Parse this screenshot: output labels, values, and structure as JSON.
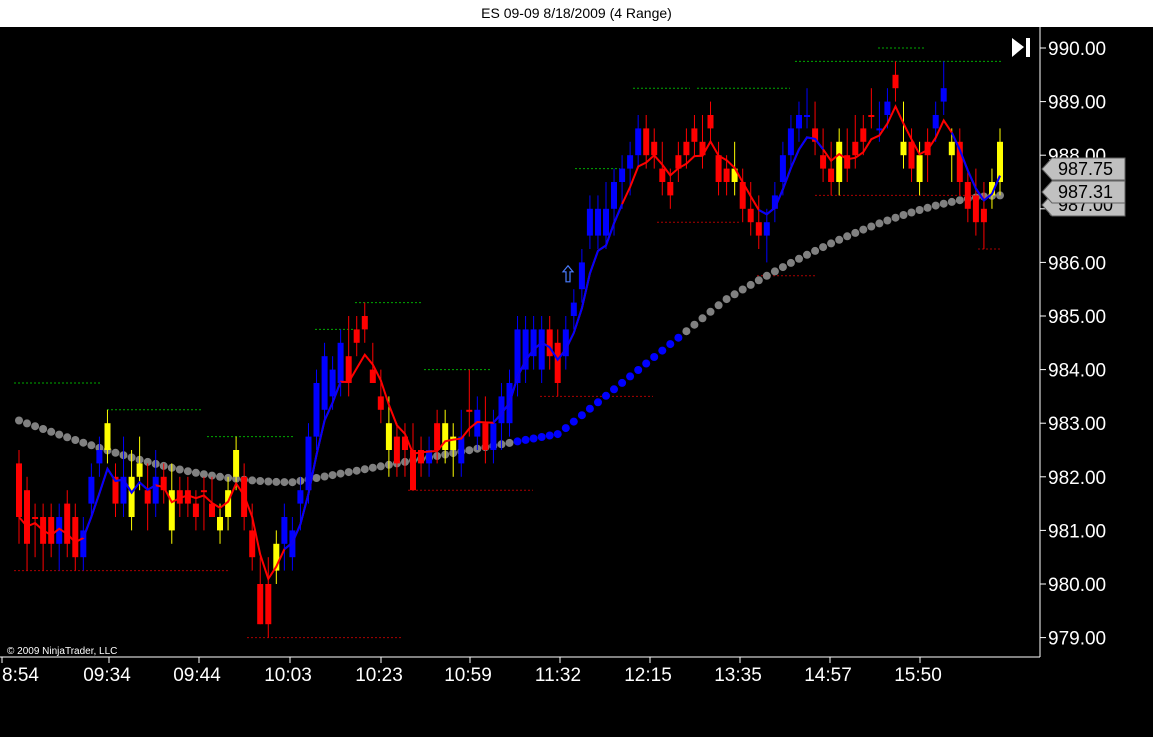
{
  "window": {
    "title": "ES 09-09  8/18/2009 (4 Range)"
  },
  "copyright": "© 2009 NinjaTrader, LLC",
  "colors": {
    "up": "#0000ff",
    "down": "#ff0000",
    "neutral": "#ffff00",
    "ema": "#ff0000",
    "sma": "#808080",
    "background": "#000000",
    "text": "#ffffff",
    "label_bg": "#c0c0c0"
  },
  "icons": {
    "go_to_end": "skip-to-end-icon",
    "entry_arrow": "up-arrow-icon"
  },
  "chart_data": {
    "type": "candlestick",
    "title": "ES 09-09  8/18/2009 (4 Range)",
    "ylim": [
      978.75,
      990.25
    ],
    "y_ticks": [
      "990.00",
      "989.00",
      "988.00",
      "987.00",
      "986.00",
      "985.00",
      "984.00",
      "983.00",
      "982.00",
      "981.00",
      "980.00",
      "979.00"
    ],
    "x_tick_labels": [
      {
        "bar": 0,
        "label": "8:54"
      },
      {
        "bar": 10,
        "label": "09:34"
      },
      {
        "bar": 20,
        "label": "09:44"
      },
      {
        "bar": 30,
        "label": "10:03"
      },
      {
        "bar": 40,
        "label": "10:23"
      },
      {
        "bar": 50,
        "label": "10:59"
      },
      {
        "bar": 60,
        "label": "11:32"
      },
      {
        "bar": 70,
        "label": "12:15"
      },
      {
        "bar": 80,
        "label": "13:35"
      },
      {
        "bar": 90,
        "label": "14:57"
      },
      {
        "bar": 100,
        "label": "15:50"
      }
    ],
    "price_labels": [
      "987.75",
      "987.31",
      "987.00"
    ],
    "grid": false,
    "bars": [
      {
        "o": 982.25,
        "h": 982.5,
        "l": 980.75,
        "c": 981.25,
        "col": "down"
      },
      {
        "o": 981.75,
        "h": 982.0,
        "l": 980.25,
        "c": 980.75,
        "col": "down"
      },
      {
        "o": 981.25,
        "h": 981.5,
        "l": 980.5,
        "c": 981.25,
        "col": "down"
      },
      {
        "o": 981.25,
        "h": 981.5,
        "l": 980.25,
        "c": 980.75,
        "col": "down"
      },
      {
        "o": 981.25,
        "h": 981.5,
        "l": 980.5,
        "c": 980.75,
        "col": "down"
      },
      {
        "o": 980.75,
        "h": 981.5,
        "l": 980.25,
        "c": 981.25,
        "col": "up"
      },
      {
        "o": 981.5,
        "h": 981.75,
        "l": 980.5,
        "c": 980.75,
        "col": "down"
      },
      {
        "o": 981.25,
        "h": 981.5,
        "l": 980.25,
        "c": 980.5,
        "col": "down"
      },
      {
        "o": 980.5,
        "h": 981.25,
        "l": 980.25,
        "c": 981.0,
        "col": "up"
      },
      {
        "o": 981.5,
        "h": 982.25,
        "l": 981.25,
        "c": 982.0,
        "col": "up"
      },
      {
        "o": 982.25,
        "h": 982.75,
        "l": 982.0,
        "c": 982.5,
        "col": "up"
      },
      {
        "o": 982.5,
        "h": 983.25,
        "l": 982.25,
        "c": 983.0,
        "col": "neutral"
      },
      {
        "o": 982.0,
        "h": 982.25,
        "l": 981.25,
        "c": 981.5,
        "col": "down"
      },
      {
        "o": 981.5,
        "h": 982.75,
        "l": 981.25,
        "c": 982.0,
        "col": "up"
      },
      {
        "o": 982.0,
        "h": 982.5,
        "l": 981.0,
        "c": 981.25,
        "col": "neutral"
      },
      {
        "o": 982.0,
        "h": 982.75,
        "l": 981.75,
        "c": 982.25,
        "col": "neutral"
      },
      {
        "o": 981.75,
        "h": 982.25,
        "l": 981.0,
        "c": 981.5,
        "col": "down"
      },
      {
        "o": 981.5,
        "h": 982.5,
        "l": 981.25,
        "c": 982.0,
        "col": "up"
      },
      {
        "o": 982.0,
        "h": 982.25,
        "l": 981.5,
        "c": 981.75,
        "col": "down"
      },
      {
        "o": 981.75,
        "h": 982.25,
        "l": 980.75,
        "c": 981.0,
        "col": "neutral"
      },
      {
        "o": 981.5,
        "h": 982.0,
        "l": 981.25,
        "c": 981.75,
        "col": "down"
      },
      {
        "o": 981.5,
        "h": 982.0,
        "l": 981.25,
        "c": 981.75,
        "col": "down"
      },
      {
        "o": 981.25,
        "h": 981.75,
        "l": 981.0,
        "c": 981.5,
        "col": "down"
      },
      {
        "o": 981.75,
        "h": 982.0,
        "l": 981.0,
        "c": 981.75,
        "col": "down"
      },
      {
        "o": 981.5,
        "h": 982.0,
        "l": 981.25,
        "c": 981.25,
        "col": "down"
      },
      {
        "o": 981.0,
        "h": 981.5,
        "l": 980.75,
        "c": 981.25,
        "col": "neutral"
      },
      {
        "o": 981.25,
        "h": 982.0,
        "l": 981.0,
        "c": 981.75,
        "col": "neutral"
      },
      {
        "o": 982.0,
        "h": 982.75,
        "l": 981.75,
        "c": 982.5,
        "col": "neutral"
      },
      {
        "o": 982.0,
        "h": 982.25,
        "l": 981.0,
        "c": 981.25,
        "col": "down"
      },
      {
        "o": 981.0,
        "h": 981.5,
        "l": 980.25,
        "c": 980.5,
        "col": "down"
      },
      {
        "o": 980.0,
        "h": 980.5,
        "l": 979.25,
        "c": 979.25,
        "col": "down"
      },
      {
        "o": 980.0,
        "h": 980.5,
        "l": 979.0,
        "c": 979.25,
        "col": "down"
      },
      {
        "o": 980.25,
        "h": 981.0,
        "l": 980.0,
        "c": 980.75,
        "col": "neutral"
      },
      {
        "o": 980.75,
        "h": 981.5,
        "l": 980.25,
        "c": 981.25,
        "col": "up"
      },
      {
        "o": 980.5,
        "h": 981.25,
        "l": 980.25,
        "c": 981.0,
        "col": "up"
      },
      {
        "o": 981.5,
        "h": 982.0,
        "l": 981.0,
        "c": 981.75,
        "col": "up"
      },
      {
        "o": 981.75,
        "h": 983.0,
        "l": 981.5,
        "c": 982.75,
        "col": "up"
      },
      {
        "o": 982.75,
        "h": 984.0,
        "l": 982.5,
        "c": 983.75,
        "col": "up"
      },
      {
        "o": 983.25,
        "h": 984.5,
        "l": 983.0,
        "c": 984.25,
        "col": "up"
      },
      {
        "o": 983.5,
        "h": 984.25,
        "l": 983.25,
        "c": 984.0,
        "col": "up"
      },
      {
        "o": 983.75,
        "h": 984.75,
        "l": 983.5,
        "c": 984.5,
        "col": "up"
      },
      {
        "o": 984.25,
        "h": 985.0,
        "l": 983.5,
        "c": 983.75,
        "col": "down"
      },
      {
        "o": 984.75,
        "h": 985.0,
        "l": 984.25,
        "c": 984.5,
        "col": "down"
      },
      {
        "o": 985.0,
        "h": 985.25,
        "l": 984.5,
        "c": 984.75,
        "col": "down"
      },
      {
        "o": 984.0,
        "h": 984.5,
        "l": 983.75,
        "c": 983.75,
        "col": "down"
      },
      {
        "o": 983.5,
        "h": 984.0,
        "l": 983.0,
        "c": 983.25,
        "col": "down"
      },
      {
        "o": 983.0,
        "h": 983.5,
        "l": 982.0,
        "c": 982.5,
        "col": "neutral"
      },
      {
        "o": 982.75,
        "h": 983.0,
        "l": 982.0,
        "c": 982.25,
        "col": "down"
      },
      {
        "o": 982.75,
        "h": 983.0,
        "l": 982.0,
        "c": 982.5,
        "col": "down"
      },
      {
        "o": 982.5,
        "h": 983.0,
        "l": 981.75,
        "c": 981.75,
        "col": "down"
      },
      {
        "o": 982.25,
        "h": 982.75,
        "l": 982.0,
        "c": 982.5,
        "col": "down"
      },
      {
        "o": 982.25,
        "h": 982.75,
        "l": 982.0,
        "c": 982.5,
        "col": "up"
      },
      {
        "o": 983.0,
        "h": 983.25,
        "l": 982.25,
        "c": 982.5,
        "col": "down"
      },
      {
        "o": 982.5,
        "h": 983.25,
        "l": 982.25,
        "c": 983.0,
        "col": "neutral"
      },
      {
        "o": 982.5,
        "h": 983.0,
        "l": 982.0,
        "c": 982.75,
        "col": "neutral"
      },
      {
        "o": 982.25,
        "h": 983.25,
        "l": 982.0,
        "c": 982.75,
        "col": "up"
      },
      {
        "o": 983.25,
        "h": 984.0,
        "l": 982.75,
        "c": 983.25,
        "col": "down"
      },
      {
        "o": 982.75,
        "h": 983.5,
        "l": 982.5,
        "c": 983.25,
        "col": "up"
      },
      {
        "o": 982.5,
        "h": 983.5,
        "l": 982.25,
        "c": 983.0,
        "col": "down"
      },
      {
        "o": 982.5,
        "h": 983.25,
        "l": 982.25,
        "c": 983.0,
        "col": "up"
      },
      {
        "o": 983.0,
        "h": 983.75,
        "l": 982.5,
        "c": 983.5,
        "col": "up"
      },
      {
        "o": 983.0,
        "h": 984.0,
        "l": 982.75,
        "c": 983.75,
        "col": "up"
      },
      {
        "o": 983.75,
        "h": 985.0,
        "l": 983.5,
        "c": 984.75,
        "col": "up"
      },
      {
        "o": 984.0,
        "h": 985.0,
        "l": 983.75,
        "c": 984.75,
        "col": "up"
      },
      {
        "o": 984.25,
        "h": 985.0,
        "l": 984.0,
        "c": 984.75,
        "col": "up"
      },
      {
        "o": 984.0,
        "h": 985.0,
        "l": 983.75,
        "c": 984.75,
        "col": "up"
      },
      {
        "o": 984.75,
        "h": 985.0,
        "l": 984.0,
        "c": 984.25,
        "col": "down"
      },
      {
        "o": 984.5,
        "h": 984.75,
        "l": 983.5,
        "c": 983.75,
        "col": "down"
      },
      {
        "o": 984.25,
        "h": 985.0,
        "l": 984.0,
        "c": 984.75,
        "col": "up"
      },
      {
        "o": 985.0,
        "h": 985.5,
        "l": 984.75,
        "c": 985.25,
        "col": "up"
      },
      {
        "o": 985.5,
        "h": 986.25,
        "l": 985.25,
        "c": 986.0,
        "col": "up"
      },
      {
        "o": 986.5,
        "h": 987.25,
        "l": 986.25,
        "c": 987.0,
        "col": "up"
      },
      {
        "o": 986.5,
        "h": 987.25,
        "l": 986.25,
        "c": 987.0,
        "col": "up"
      },
      {
        "o": 987.0,
        "h": 987.5,
        "l": 986.25,
        "c": 986.5,
        "col": "up"
      }
    ],
    "ema_series": [],
    "sma_series": []
  }
}
